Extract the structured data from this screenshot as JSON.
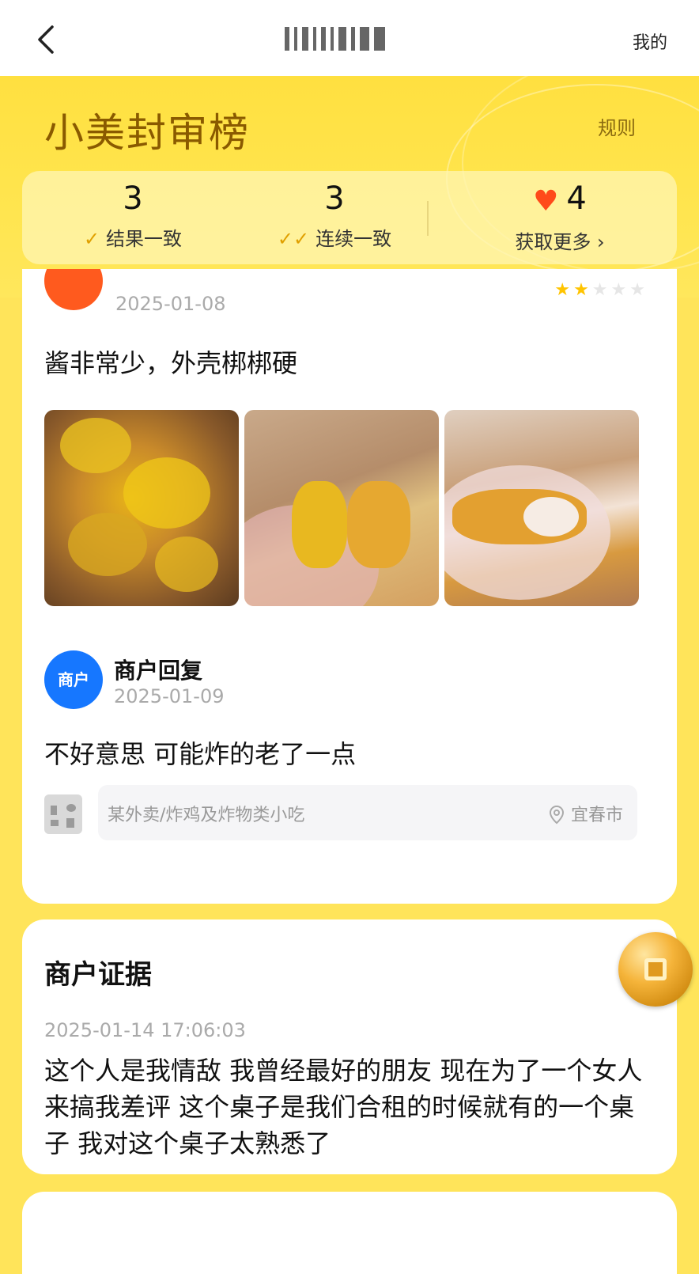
{
  "nav": {
    "mine_label": "我的"
  },
  "header": {
    "title": "小美封审榜",
    "rules_label": "规则"
  },
  "stats": [
    {
      "value": "3",
      "label": "结果一致",
      "icon": "check-icon"
    },
    {
      "value": "3",
      "label": "连续一致",
      "icon": "double-check-icon"
    },
    {
      "value": "4",
      "label": "获取更多",
      "icon": "heart-icon"
    }
  ],
  "review": {
    "date": "2025-01-08",
    "rating": 2,
    "text": "酱非常少，外壳梆梆硬",
    "photos": [
      "fried-chicken-box-photo",
      "fried-chicken-hand-photo",
      "fried-chicken-bitten-photo"
    ]
  },
  "merchant_reply": {
    "avatar_label": "商户",
    "name": "商户回复",
    "date": "2025-01-09",
    "text": "不好意思 可能炸的老了一点"
  },
  "store": {
    "category": "某外卖/炸鸡及炸物类小吃",
    "location": "宜春市"
  },
  "evidence": {
    "title": "商户证据",
    "date": "2025-01-14 17:06:03",
    "text": "这个人是我情敌 我曾经最好的朋友 现在为了一个女人来搞我差评 这个桌子是我们合租的时候就有的一个桌子 我对这个桌子太熟悉了"
  },
  "colors": {
    "brand_yellow": "#ffe45a",
    "heart": "#ff4a1a",
    "merchant_blue": "#1677ff",
    "user_orange": "#ff5a1e"
  }
}
